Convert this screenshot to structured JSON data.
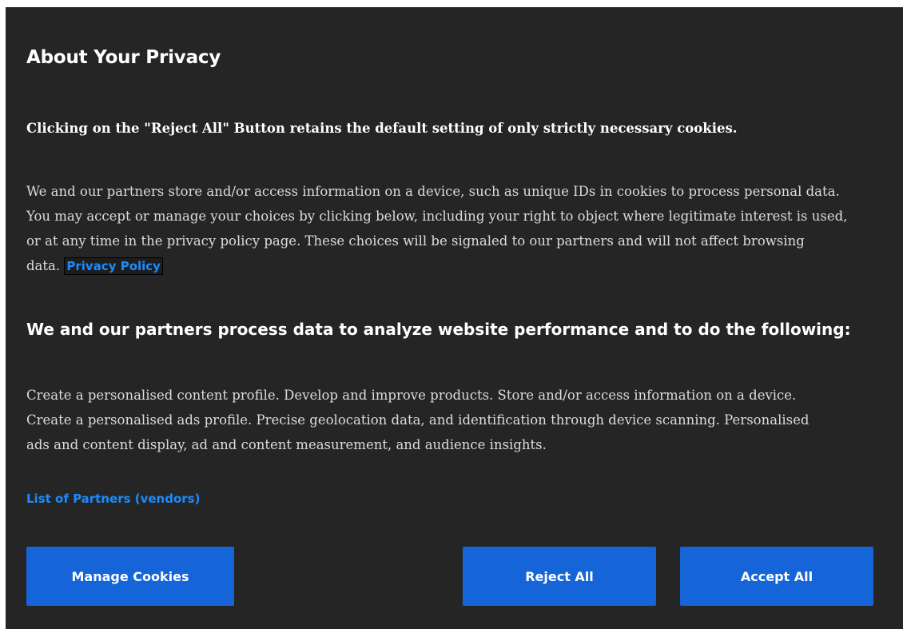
{
  "dialog": {
    "title": "About Your Privacy",
    "reject_note": "Clicking on the \"Reject All\" Button retains the default setting of only strictly necessary cookies.",
    "description": "We and our partners store and/or access information on a device, such as unique IDs in cookies to process personal data. You may accept or manage your choices by clicking below, including your right to object where legitimate interest is used, or at any time in the privacy policy page. These choices will be signaled to our partners and will not affect browsing data.",
    "privacy_policy_link": "Privacy Policy",
    "purposes_heading": "We and our partners process data to analyze website performance and to do the following:",
    "purposes_text": "Create a personalised content profile. Develop and improve products. Store and/or access information on a device. Create a personalised ads profile. Precise geolocation data, and identification through device scanning. Personalised ads and content display, ad and content measurement, and audience insights.",
    "vendors_link": "List of Partners (vendors)"
  },
  "buttons": {
    "manage": "Manage Cookies",
    "reject": "Reject All",
    "accept": "Accept All"
  },
  "colors": {
    "background": "#252525",
    "link": "#1a8cff",
    "button": "#1565d8"
  }
}
